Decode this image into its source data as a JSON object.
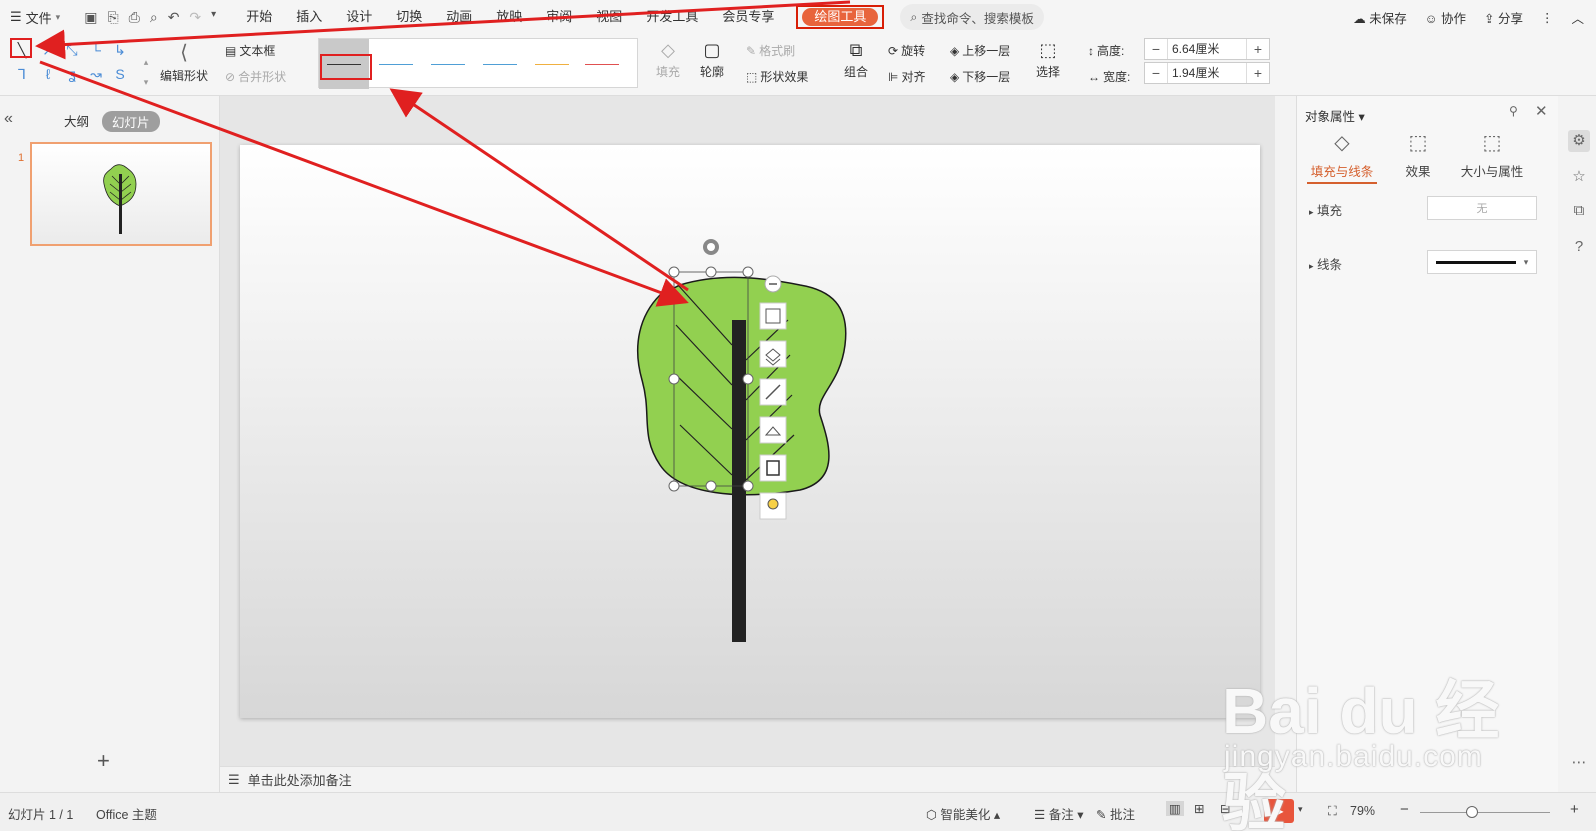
{
  "menu": {
    "file_label": "文件",
    "tabs": [
      "开始",
      "插入",
      "设计",
      "切换",
      "动画",
      "放映",
      "审阅",
      "视图",
      "开发工具",
      "会员专享"
    ],
    "active_tool_tab": "绘图工具",
    "search_label": "查找命令、搜索模板",
    "unsaved": "未保存",
    "collab": "协作",
    "share": "分享"
  },
  "ribbon": {
    "edit_shape": "编辑形状",
    "textbox": "文本框",
    "merge_shapes": "合并形状",
    "fill": "填充",
    "outline": "轮廓",
    "format_painter": "格式刷",
    "shape_effects": "形状效果",
    "group": "组合",
    "rotate": "旋转",
    "align": "对齐",
    "bring_forward": "上移一层",
    "send_backward": "下移一层",
    "select": "选择",
    "height_label": "高度:",
    "height_value": "6.64厘米",
    "width_label": "宽度:",
    "width_value": "1.94厘米",
    "line_colors": [
      "#333333",
      "#4f9fd6",
      "#4f9fd6",
      "#4f9fd6",
      "#f0b040",
      "#e05050"
    ]
  },
  "left_panel": {
    "outline_tab": "大纲",
    "slides_tab": "幻灯片",
    "slide_number": "1"
  },
  "notes_placeholder": "单击此处添加备注",
  "right_panel": {
    "title": "对象属性",
    "tab_fill_line": "填充与线条",
    "tab_effects": "效果",
    "tab_size_props": "大小与属性",
    "fill_label": "填充",
    "fill_value": "无",
    "line_label": "线条"
  },
  "status": {
    "slide_info": "幻灯片 1 / 1",
    "theme": "Office 主题",
    "smart_beautify": "智能美化",
    "notes": "备注",
    "comments": "批注",
    "zoom": "79%"
  },
  "watermark": {
    "brand": "Bai du 经验",
    "site": "jingyan.baidu.com"
  },
  "colors": {
    "accent": "#d5602e",
    "leaf": "#92d050",
    "trunk": "#222222",
    "annotation_red": "#e02020"
  }
}
